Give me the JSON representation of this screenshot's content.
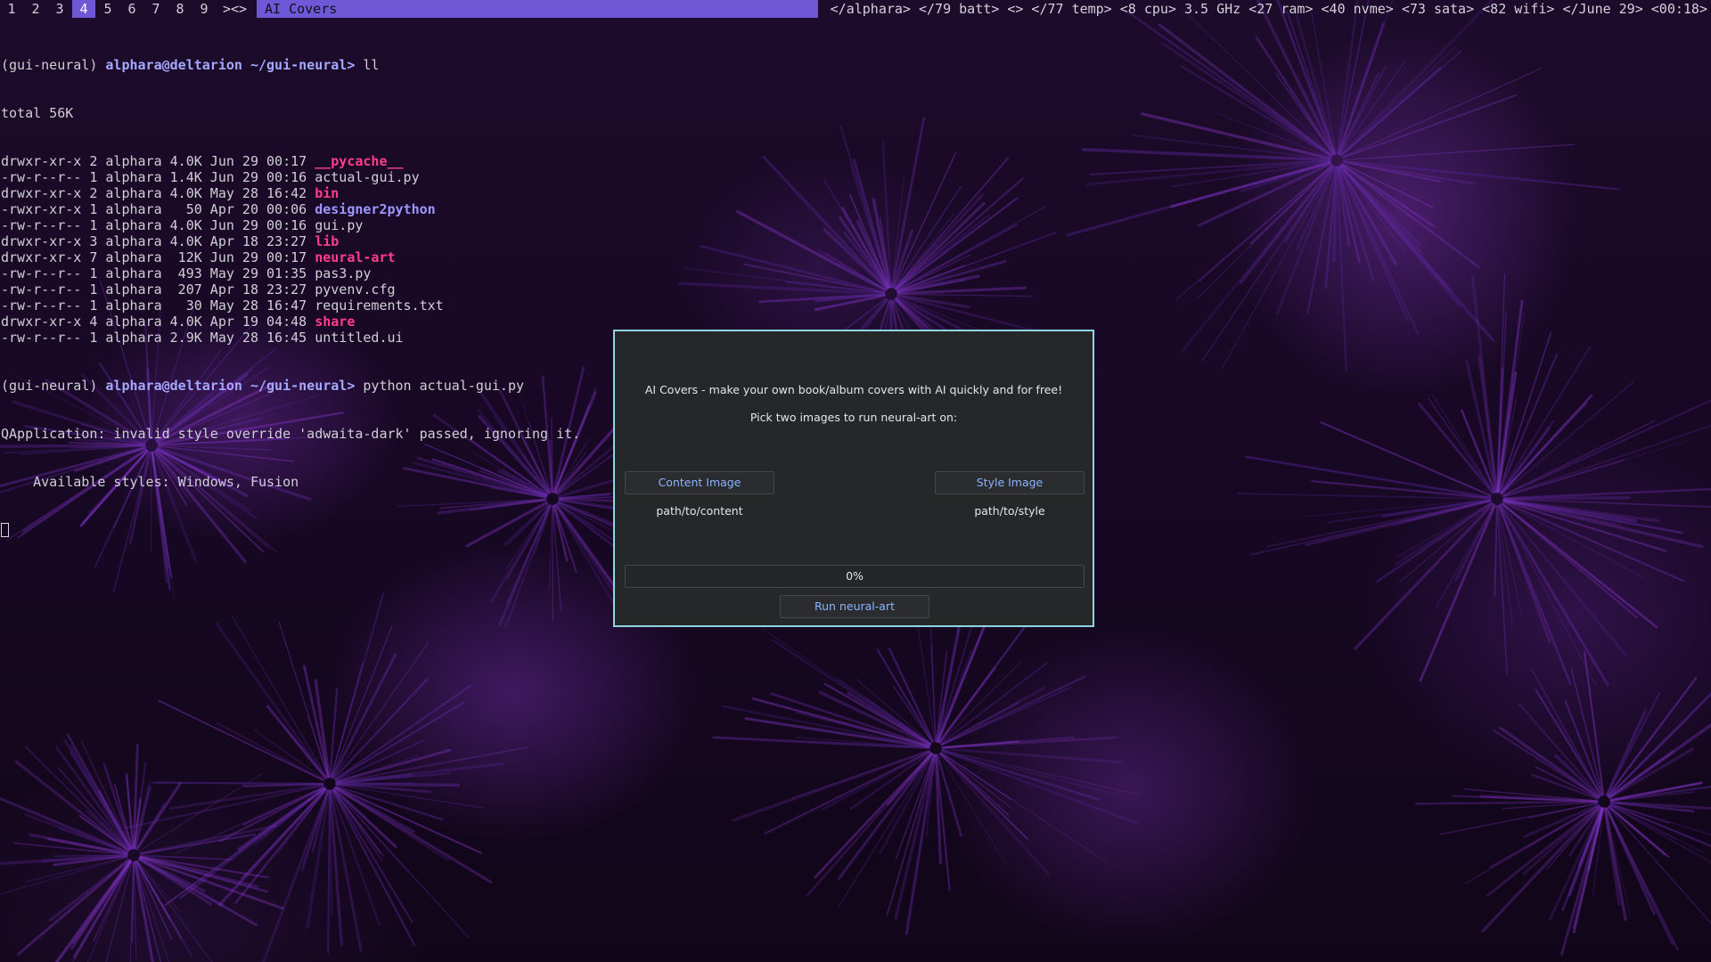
{
  "topbar": {
    "workspaces": [
      {
        "label": "1",
        "active": false
      },
      {
        "label": "2",
        "active": false
      },
      {
        "label": "3",
        "active": false
      },
      {
        "label": "4",
        "active": true
      },
      {
        "label": "5",
        "active": false
      },
      {
        "label": "6",
        "active": false
      },
      {
        "label": "7",
        "active": false
      },
      {
        "label": "8",
        "active": false
      },
      {
        "label": "9",
        "active": false
      }
    ],
    "layout_indicator": "><>",
    "window_title": "AI Covers",
    "status": "</alphara> </79 batt> <> </77 temp> <8 cpu> 3.5 GHz <27 ram> <40 nvme> <73 sata> <82 wifi> </June 29> <00:18>"
  },
  "terminal": {
    "prompt1": {
      "env": "(gui-neural) ",
      "user": "alphara@deltarion",
      "path": " ~/gui-neural> ",
      "cmd": "ll"
    },
    "total": "total 56K",
    "listing": [
      {
        "meta": "drwxr-xr-x 2 alphara 4.0K Jun 29 00:17 ",
        "name": "__pycache__",
        "kind": "dir"
      },
      {
        "meta": "-rw-r--r-- 1 alphara 1.4K Jun 29 00:16 ",
        "name": "actual-gui.py",
        "kind": "file"
      },
      {
        "meta": "drwxr-xr-x 2 alphara 4.0K May 28 16:42 ",
        "name": "bin",
        "kind": "dir"
      },
      {
        "meta": "-rwxr-xr-x 1 alphara   50 Apr 20 00:06 ",
        "name": "designer2python",
        "kind": "exe"
      },
      {
        "meta": "-rw-r--r-- 1 alphara 4.0K Jun 29 00:16 ",
        "name": "gui.py",
        "kind": "file"
      },
      {
        "meta": "drwxr-xr-x 3 alphara 4.0K Apr 18 23:27 ",
        "name": "lib",
        "kind": "dir"
      },
      {
        "meta": "drwxr-xr-x 7 alphara  12K Jun 29 00:17 ",
        "name": "neural-art",
        "kind": "dir"
      },
      {
        "meta": "-rw-r--r-- 1 alphara  493 May 29 01:35 ",
        "name": "pas3.py",
        "kind": "file"
      },
      {
        "meta": "-rw-r--r-- 1 alphara  207 Apr 18 23:27 ",
        "name": "pyvenv.cfg",
        "kind": "file"
      },
      {
        "meta": "-rw-r--r-- 1 alphara   30 May 28 16:47 ",
        "name": "requirements.txt",
        "kind": "file"
      },
      {
        "meta": "drwxr-xr-x 4 alphara 4.0K Apr 19 04:48 ",
        "name": "share",
        "kind": "dir"
      },
      {
        "meta": "-rw-r--r-- 1 alphara 2.9K May 28 16:45 ",
        "name": "untitled.ui",
        "kind": "file"
      }
    ],
    "prompt2": {
      "env": "(gui-neural) ",
      "user": "alphara@deltarion",
      "path": " ~/gui-neural> ",
      "cmd": "python actual-gui.py"
    },
    "output": [
      "QApplication: invalid style override 'adwaita-dark' passed, ignoring it.",
      "    Available styles: Windows, Fusion"
    ]
  },
  "dialog": {
    "heading": "AI Covers - make your own book/album covers with AI quickly and for free!",
    "subheading": "Pick two images to run neural-art on:",
    "content_button": "Content Image",
    "style_button": "Style Image",
    "content_path": "path/to/content",
    "style_path": "path/to/style",
    "progress": 0,
    "progress_label": "0%",
    "run_button": "Run neural-art"
  },
  "colors": {
    "accent": "#6e58d6",
    "dialog_border": "#8fd5e2",
    "dir_color": "#ff3d8a",
    "exe_color": "#9d97ff",
    "user_color": "#a5a8ff",
    "button_text": "#8ab4ff"
  }
}
